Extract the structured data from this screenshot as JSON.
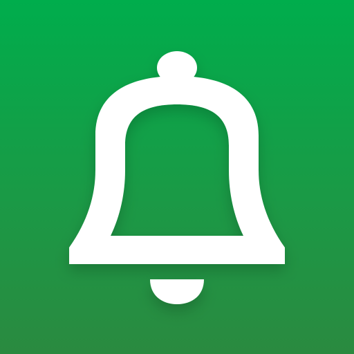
{
  "app_icon": {
    "icon": "bell-icon",
    "background_color_top": "#00ad4c",
    "background_color_bottom": "#2a8a40",
    "glyph_color": "#ffffff"
  }
}
